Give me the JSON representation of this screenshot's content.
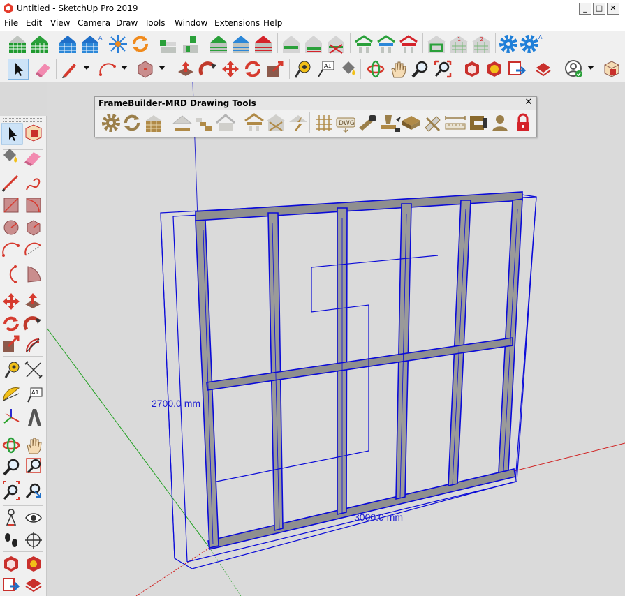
{
  "window": {
    "title": "Untitled - SketchUp Pro 2019",
    "minimize_glyph": "_",
    "maximize_glyph": "□",
    "close_glyph": "✕"
  },
  "menu": [
    "File",
    "Edit",
    "View",
    "Camera",
    "Draw",
    "Tools",
    "Window",
    "Extensions",
    "Help"
  ],
  "toolbar_top": {
    "icons": [
      "house-grid-green-icon",
      "house-grid-green-icon",
      "house-blue-icon",
      "house-blue-a-icon",
      "framing-star-icon",
      "refresh-orange-icon",
      "wall-panel-icon",
      "wall-panel-icon",
      "house-green-icon",
      "house-blue-icon",
      "house-red-icon",
      "wall-green-icon",
      "wall-red-icon",
      "wall-cross-red-icon",
      "truss-green-icon",
      "truss-blue-icon",
      "truss-red-icon",
      "window-frame-icon",
      "window-frame-1-icon",
      "window-frame-2-icon",
      "settings-gear-blue-icon",
      "settings-gear-blue-a-icon"
    ],
    "badge_a": "A",
    "badge_1": "1",
    "badge_2": "2"
  },
  "toolbar_second": {
    "icons": [
      "select-arrow-icon",
      "eraser-icon",
      "pencil-icon",
      "dropdown-icon",
      "arc-icon",
      "dropdown-icon",
      "polygon-icon",
      "dropdown-icon",
      "push-pull-icon",
      "follow-me-icon",
      "move-icon",
      "rotate-icon",
      "scale-icon",
      "tape-measure-icon",
      "text-icon",
      "paint-bucket-icon",
      "orbit-icon",
      "pan-icon",
      "zoom-icon",
      "zoom-extents-icon",
      "3d-warehouse-icon",
      "extension-warehouse-icon",
      "send-to-layout-icon",
      "extension-manager-icon",
      "profile-icon",
      "dropdown-icon",
      "component-icon"
    ],
    "text_tool_label": "A1"
  },
  "framebuilder": {
    "title": "FrameBuilder-MRD Drawing Tools",
    "close": "✕",
    "dwg_label": "DWG",
    "icons": [
      "fb-settings-gear-icon",
      "fb-refresh-icon",
      "fb-wall-panel-icon",
      "fb-roof-icon",
      "fb-stairs-icon",
      "fb-gable-icon",
      "fb-roof-frame-icon",
      "fb-cross-brace-icon",
      "fb-truss-arrow-icon",
      "fb-grid-icon",
      "fb-dwg-export-icon",
      "fb-saw-icon",
      "fb-nail-gun-icon",
      "fb-timber-stack-icon",
      "fb-ruler-pencil-icon",
      "fb-measure-icon",
      "fb-clamp-icon",
      "fb-user-icon",
      "fb-lock-icon"
    ]
  },
  "left_toolbar": {
    "text_tool_label": "A1",
    "icons": [
      "select-icon",
      "make-component-icon",
      "paint-bucket-icon",
      "eraser-icon",
      "line-icon",
      "freehand-icon",
      "rectangle-icon",
      "rotated-rectangle-icon",
      "circle-icon",
      "polygon-icon",
      "arc-icon",
      "two-point-arc-icon",
      "three-point-arc-icon",
      "pie-icon",
      "move-icon",
      "push-pull-icon",
      "rotate-icon",
      "follow-me-icon",
      "scale-icon",
      "offset-icon",
      "tape-measure-icon",
      "dimension-icon",
      "protractor-icon",
      "text-icon",
      "axes-icon",
      "3d-text-icon",
      "orbit-icon",
      "pan-icon",
      "zoom-icon",
      "zoom-window-icon",
      "zoom-extents-icon",
      "previous-view-icon",
      "position-camera-icon",
      "look-around-icon",
      "walk-icon",
      "section-plane-icon",
      "3d-warehouse-icon",
      "extension-warehouse-icon",
      "send-to-layout-icon",
      "extension-manager-icon"
    ]
  },
  "model": {
    "height_dimension": "2700.0 mm",
    "width_dimension": "3000.0 mm"
  },
  "colors": {
    "frame_blue": "#0a0ad8",
    "stud_gray": "#9a9a9a",
    "axis_green": "#22a022",
    "axis_red": "#d01f1f",
    "axis_blue": "#2b2bd0",
    "viewport_bg": "#dadada"
  }
}
